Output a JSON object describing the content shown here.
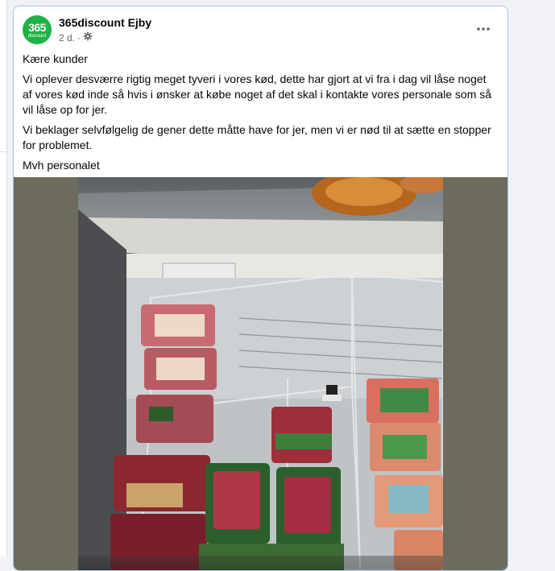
{
  "post": {
    "page_name": "365discount Ejby",
    "avatar_main": "365",
    "avatar_sub": "discount",
    "time": "2 d.",
    "separator": "·",
    "audience_icon": "gear-icon",
    "more_label": "•••",
    "paragraphs": [
      "Kære kunder",
      "Vi oplever desværre rigtig meget tyveri i vores kød, dette har gjort at vi fra i dag vil låse noget af vores kød inde så hvis i ønsker at købe noget af det skal i kontakte vores personale som så vil låse op for jer.",
      "Vi beklager selvfølgelig de gener dette måtte have for jer, men vi er nød til at sætte en stopper for problemet.",
      "Mvh personalet"
    ]
  },
  "colors": {
    "brand_green": "#1db345",
    "card_border": "#a8c3ee",
    "photo_background": "#6d6b5e"
  }
}
